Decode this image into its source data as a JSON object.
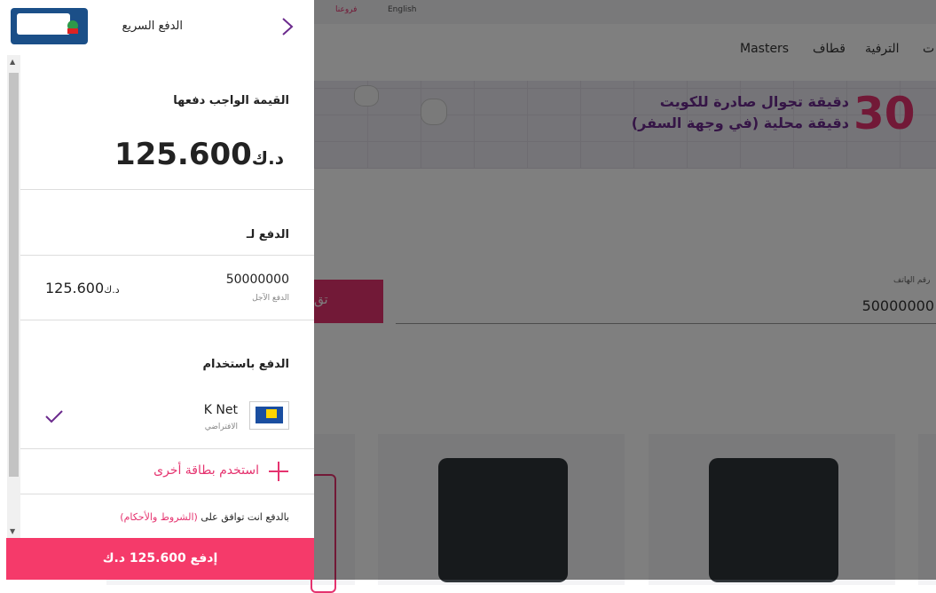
{
  "background": {
    "topbar": {
      "lang": "English",
      "branches": "فروعنا"
    },
    "nav": {
      "items": [
        "Masters",
        "قطاف",
        "الترفية",
        "ت"
      ]
    },
    "banner": {
      "number": "30",
      "line1": "دقيقة تجوال صادرة للكويت",
      "line2": "دقيقة محلية (في وجهة السفر)"
    },
    "phone": {
      "label": "رقم الهاتف",
      "value": "50000000"
    },
    "button_fragment": "تق"
  },
  "panel": {
    "title": "الدفع السريع",
    "amount_label": "القيمة الواجب دفعها",
    "amount": "125.600",
    "currency": "د.ك",
    "pay_for_label": "الدفع لـ",
    "account_number": "50000000",
    "account_type": "الدفع الآجل",
    "account_amount": "125.600",
    "pay_using_label": "الدفع باستخدام",
    "method_name": "K Net",
    "method_note": "الافتراضي",
    "other_card": "استخدم بطاقة أخرى",
    "terms_prefix": "بالدفع انت توافق على ",
    "terms_link": "(الشروط والأحكام)",
    "pay_button": "إدفع 125.600 د.ك"
  },
  "colors": {
    "accent": "#f53a6a",
    "purple": "#6b2a8d"
  }
}
